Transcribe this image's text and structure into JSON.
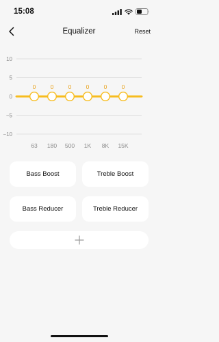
{
  "status_bar": {
    "time": "15:08",
    "icons": [
      "signal-icon",
      "wifi-icon",
      "battery-icon"
    ]
  },
  "header": {
    "title": "Equalizer",
    "reset_label": "Reset",
    "back_icon": "chevron-left-icon"
  },
  "equalizer": {
    "y_ticks": [
      "10",
      "5",
      "0",
      "−5",
      "−10"
    ],
    "y_range": [
      -10,
      10
    ],
    "bands": [
      {
        "label": "63",
        "gain": 0,
        "value_label": "0"
      },
      {
        "label": "180",
        "gain": 0,
        "value_label": "0"
      },
      {
        "label": "500",
        "gain": 0,
        "value_label": "0"
      },
      {
        "label": "1K",
        "gain": 0,
        "value_label": "0"
      },
      {
        "label": "8K",
        "gain": 0,
        "value_label": "0"
      },
      {
        "label": "15K",
        "gain": 0,
        "value_label": "0"
      }
    ]
  },
  "presets": [
    {
      "label": "Bass Boost"
    },
    {
      "label": "Treble Boost"
    },
    {
      "label": "Bass Reducer"
    },
    {
      "label": "Treble Reducer"
    }
  ],
  "add_icon": "plus-icon",
  "colors": {
    "accent": "#F7BC1E",
    "value_text": "#E9A21A",
    "background": "#F6F6F6",
    "card": "#FFFFFF",
    "gridline": "#D9D9D9",
    "muted_text": "#8A8A8A"
  }
}
